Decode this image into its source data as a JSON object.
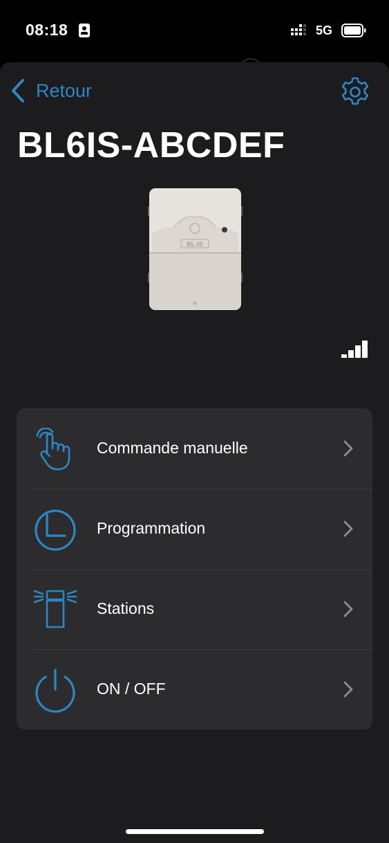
{
  "status_bar": {
    "time": "08:18",
    "network": "5G"
  },
  "header": {
    "back_label": "Retour",
    "back_icon": "chevron-left-icon",
    "settings_icon": "gear-icon"
  },
  "device": {
    "name": "BL6IS-ABCDEF",
    "model_label": "BL-IS",
    "signal_icon": "signal-strength-icon",
    "signal_bars_filled": 4,
    "signal_bars_total": 4
  },
  "menu": {
    "items": [
      {
        "label": "Commande manuelle",
        "icon": "hand-tap-icon"
      },
      {
        "label": "Programmation",
        "icon": "clock-icon"
      },
      {
        "label": "Stations",
        "icon": "station-valve-icon"
      },
      {
        "label": "ON / OFF",
        "icon": "power-icon"
      }
    ]
  },
  "colors": {
    "accent": "#2f86c5",
    "background": "#1c1c1e",
    "card": "#2c2c2e",
    "text": "#ffffff"
  }
}
